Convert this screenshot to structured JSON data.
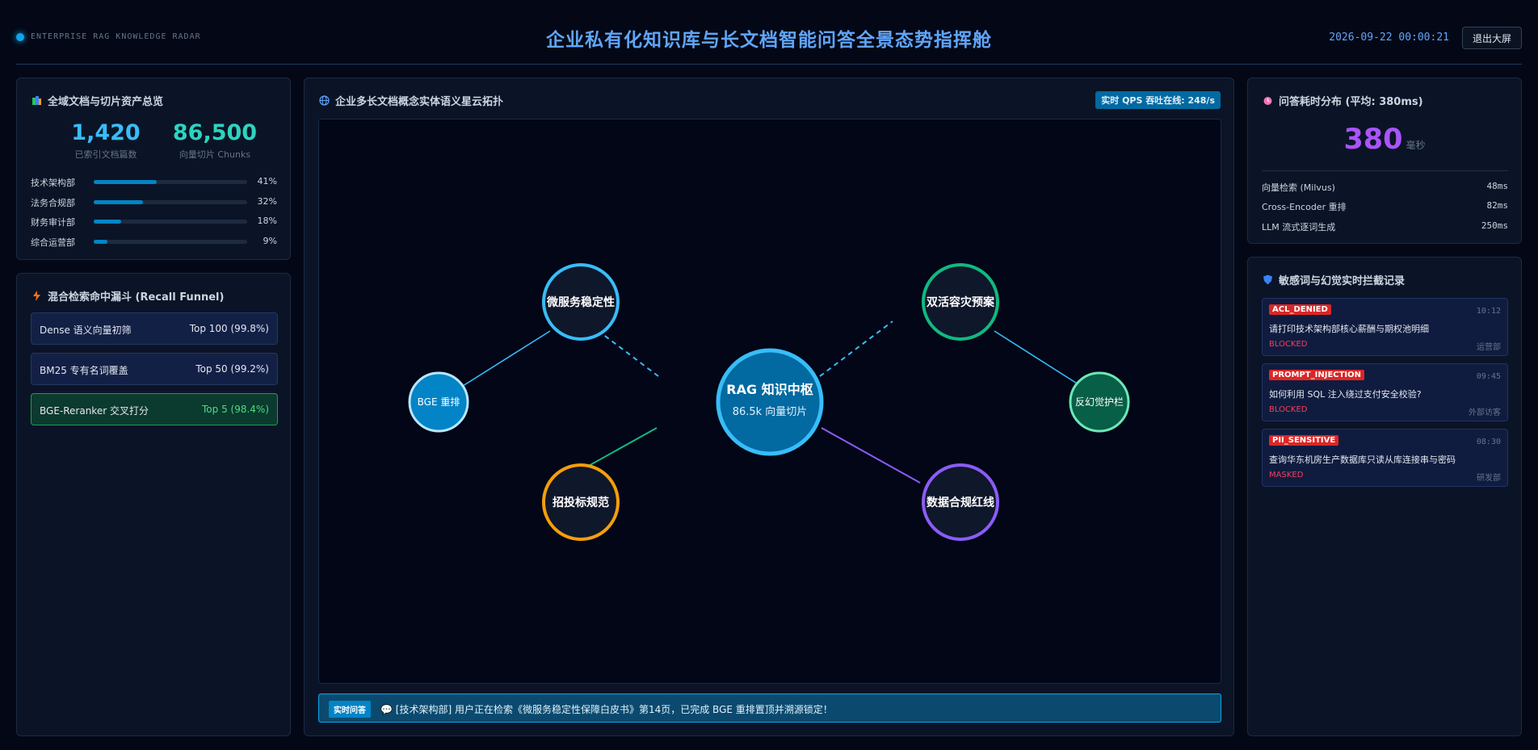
{
  "header": {
    "brand": "ENTERPRISE RAG KNOWLEDGE RADAR",
    "title": "企业私有化知识库与长文档智能问答全景态势指挥舱",
    "clock": "2026-09-22 00:00:21",
    "exit_label": "退出大屏"
  },
  "assets": {
    "title": "全域文档与切片资产总览",
    "docs_count": "1,420",
    "docs_label": "已索引文档篇数",
    "chunks_count": "86,500",
    "chunks_label": "向量切片 Chunks",
    "departments": [
      {
        "name": "技术架构部",
        "pct_label": "41%",
        "pct": 41
      },
      {
        "name": "法务合规部",
        "pct_label": "32%",
        "pct": 32
      },
      {
        "name": "财务审计部",
        "pct_label": "18%",
        "pct": 18
      },
      {
        "name": "综合运营部",
        "pct_label": "9%",
        "pct": 9
      }
    ]
  },
  "funnel": {
    "title": "混合检索命中漏斗 (Recall Funnel)",
    "stages": [
      {
        "name": "Dense 语义向量初筛",
        "value": "Top 100 (99.8%)"
      },
      {
        "name": "BM25 专有名词覆盖",
        "value": "Top 50 (99.2%)"
      },
      {
        "name": "BGE-Reranker 交叉打分",
        "value": "Top 5 (98.4%)"
      }
    ]
  },
  "graph": {
    "title": "企业多长文档概念实体语义星云拓扑",
    "qps_label": "实时 QPS 吞吐在线: 248/s",
    "center_title": "RAG 知识中枢",
    "center_sub": "86.5k 向量切片",
    "nodes": {
      "microservice": "微服务稳定性",
      "dr": "双活容灾预案",
      "bge": "BGE 重排",
      "anti_hallucination": "反幻觉护栏",
      "bidding": "招投标规范",
      "compliance": "数据合规红线"
    },
    "colors": {
      "center": "#38bdf8",
      "blue": "#38bdf8",
      "green": "#10b981",
      "orange": "#f59e0b",
      "purple": "#8b5cf6"
    }
  },
  "live": {
    "tag": "实时问答",
    "message": "[技术架构部] 用户正在检索《微服务稳定性保障白皮书》第14页，已完成 BGE 重排置顶并溯源锁定！"
  },
  "latency": {
    "title": "问答耗时分布 (平均: 380ms)",
    "value": "380",
    "unit": "毫秒",
    "items": [
      {
        "name": "向量检索 (Milvus)",
        "value": "48ms"
      },
      {
        "name": "Cross-Encoder 重排",
        "value": "82ms"
      },
      {
        "name": "LLM 流式逐词生成",
        "value": "250ms"
      }
    ]
  },
  "intercepts": {
    "title": "敏感词与幻觉实时拦截记录",
    "items": [
      {
        "badge": "ACL_DENIED",
        "time": "10:12",
        "text": "请打印技术架构部核心薪酬与期权池明细",
        "status": "BLOCKED",
        "source": "运营部"
      },
      {
        "badge": "PROMPT_INJECTION",
        "time": "09:45",
        "text": "如何利用 SQL 注入绕过支付安全校验?",
        "status": "BLOCKED",
        "source": "外部访客"
      },
      {
        "badge": "PII_SENSITIVE",
        "time": "08:30",
        "text": "查询华东机房生产数据库只读从库连接串与密码",
        "status": "MASKED",
        "source": "研发部"
      }
    ]
  }
}
